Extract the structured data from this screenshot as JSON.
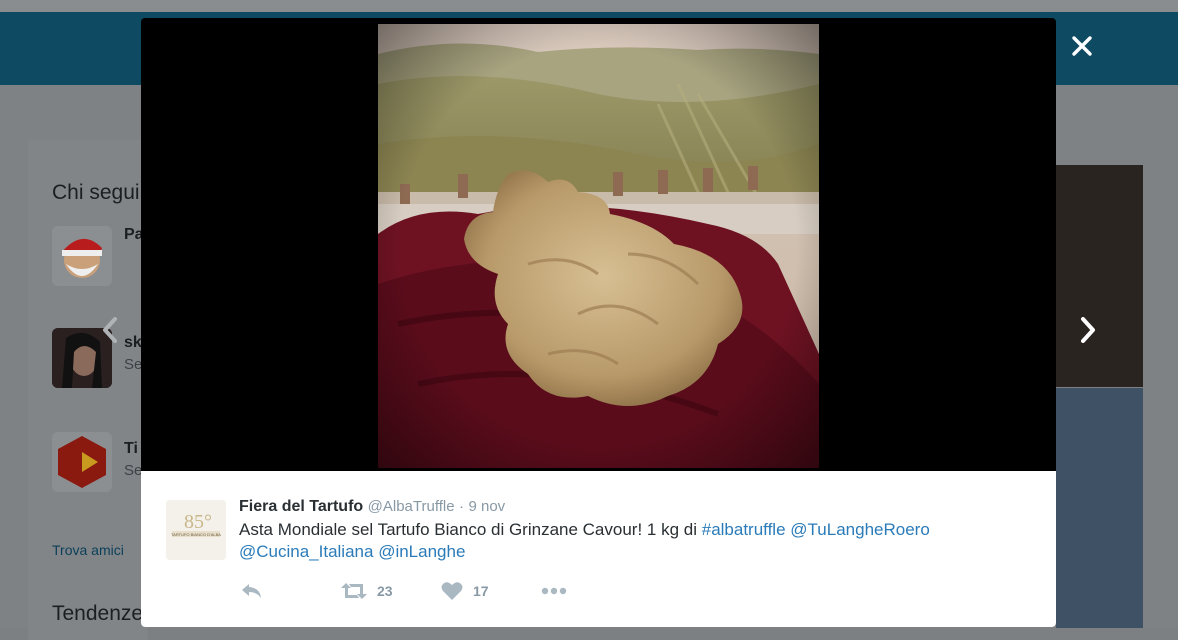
{
  "background": {
    "sidebar_title": "Chi segui",
    "follow_items": [
      {
        "name": "Pa",
        "sub": ""
      },
      {
        "name": "sk",
        "sub": "Se"
      },
      {
        "name": "Ti",
        "sub": "Se"
      }
    ],
    "find_friends": "Trova amici",
    "trends_title": "Tendenze"
  },
  "tweet": {
    "fullname": "Fiera del Tartufo",
    "username": "@AlbaTruffle",
    "separator": "·",
    "time": "9 nov",
    "text_plain": "Asta Mondiale sel Tartufo Bianco di Grinzane Cavour! 1 kg di",
    "hashtag": "#albatruffle",
    "mention1": "@TuLangheRoero",
    "mention2": "@Cucina_Italiana",
    "mention3": "@inLanghe",
    "retweets": "23",
    "likes": "17",
    "avatar_text": "TARTUFO BIANCO D'ALBA"
  },
  "controls": {
    "close": "×"
  },
  "colors": {
    "link": "#2b7bb9",
    "text": "#292f33",
    "muted": "#8899a6"
  }
}
